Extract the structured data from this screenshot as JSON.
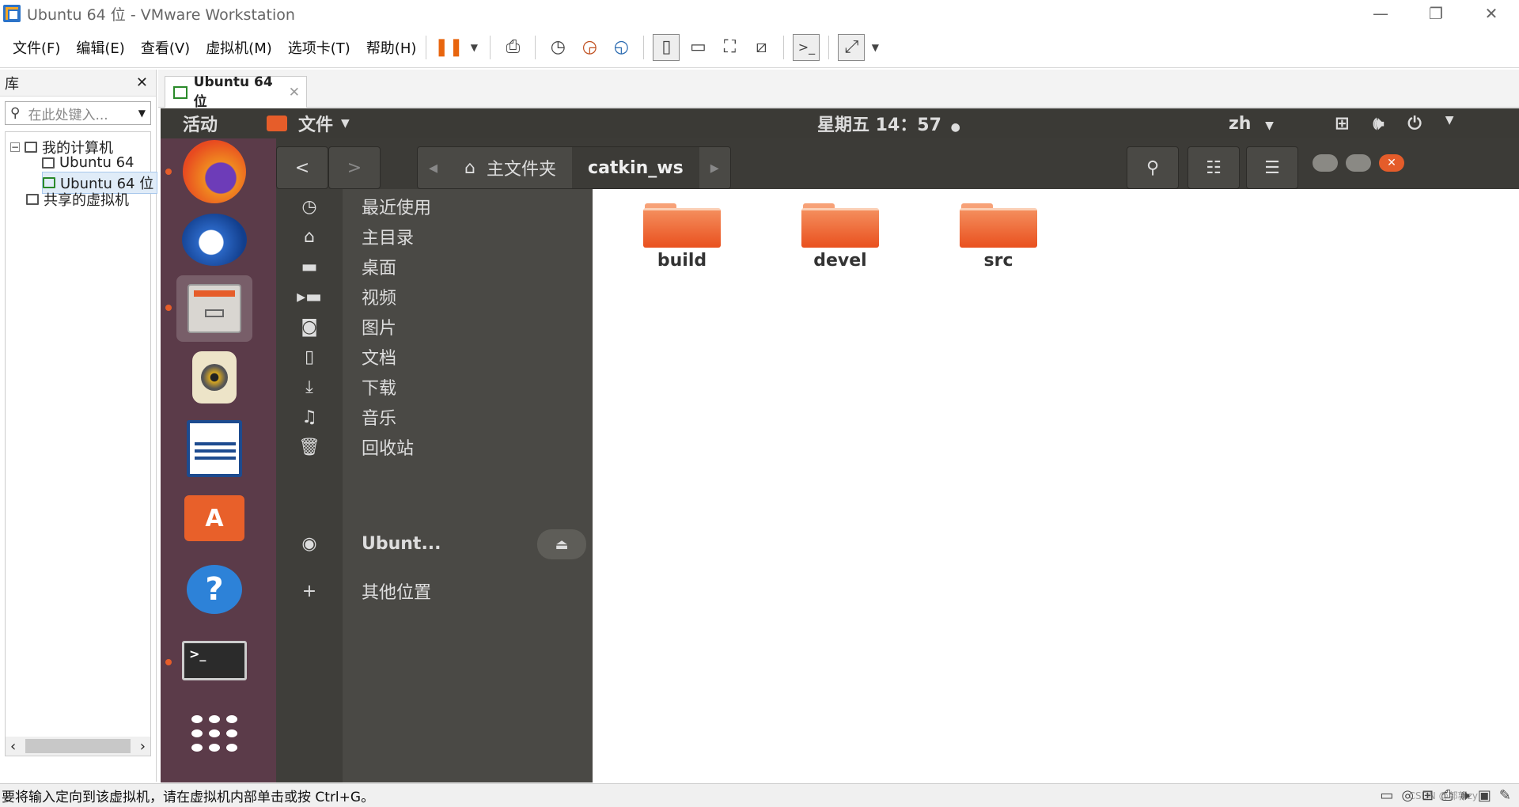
{
  "window": {
    "title": "Ubuntu 64 位 - VMware Workstation",
    "minimize": "—",
    "restore": "❐",
    "close": "✕"
  },
  "menu": {
    "file": "文件(F)",
    "edit": "编辑(E)",
    "view": "查看(V)",
    "vm": "虚拟机(M)",
    "tabs": "选项卡(T)",
    "help": "帮助(H)"
  },
  "library": {
    "title": "库",
    "close": "✕",
    "search_placeholder": "在此处键入...",
    "tree": {
      "my_computer": "我的计算机",
      "vm1": "Ubuntu 64",
      "vm2": "Ubuntu 64 位",
      "shared": "共享的虚拟机"
    }
  },
  "tab": {
    "label": "Ubuntu 64 位"
  },
  "ubuntu": {
    "activities": "活动",
    "app_menu": "文件",
    "clock": "星期五 14：57",
    "lang": "zh",
    "dock": [
      "firefox-icon",
      "thunderbird-icon",
      "files-icon",
      "rhythmbox-icon",
      "libreoffice-writer-icon",
      "software-center-icon",
      "help-icon",
      "terminal-icon",
      "app-grid-icon"
    ]
  },
  "nautilus": {
    "path": {
      "home": "主文件夹",
      "current": "catkin_ws"
    },
    "sidebar": {
      "recent": "最近使用",
      "home": "主目录",
      "desktop": "桌面",
      "videos": "视频",
      "pictures": "图片",
      "documents": "文档",
      "downloads": "下载",
      "music": "音乐",
      "trash": "回收站",
      "device": "Ubunt...",
      "other": "其他位置"
    },
    "folders": [
      "build",
      "devel",
      "src"
    ]
  },
  "status": {
    "text": "要将输入定向到该虚拟机，请在虚拟机内部单击或按 Ctrl+G。",
    "watermark": "CSDN @郭郭zy"
  },
  "colors": {
    "accent": "#e65d2a",
    "dock": "#5b3b49",
    "topbar": "#3b3a36",
    "sidebar": "#4a4945"
  }
}
